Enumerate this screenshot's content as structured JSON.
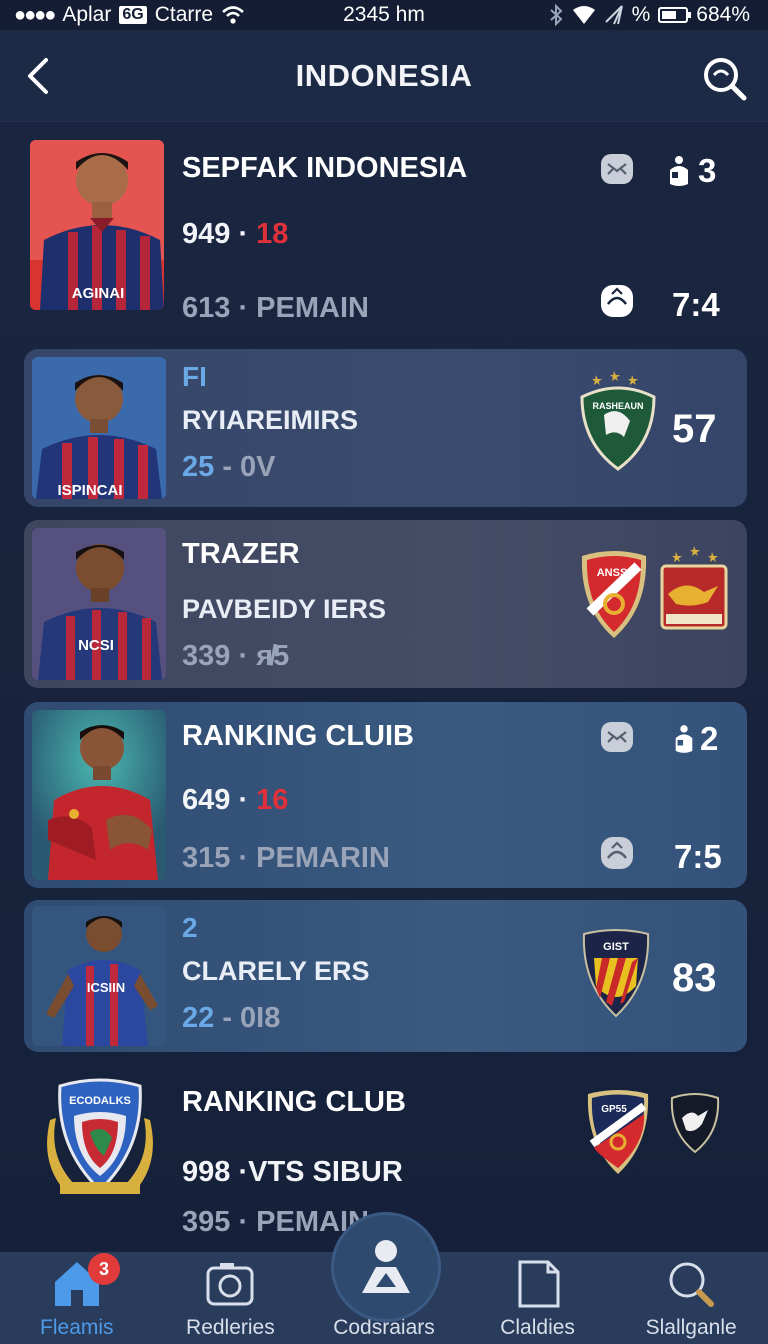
{
  "status_bar": {
    "carrier_left": "Aplar",
    "carrier_box": "6G",
    "carrier_name": "Ctarre",
    "time": "2345 hm",
    "percent_sign": "%",
    "battery": "684%"
  },
  "header": {
    "title": "INDONESIA"
  },
  "rows": [
    {
      "title": "SEPFAK INDONESIA",
      "stat_main": "949 ·",
      "stat_red": "18",
      "stat_dim": "613 ·",
      "label": "PEMAIN",
      "count_top": "3",
      "count_bottom": "7:4",
      "jersey_text": "AGINAI"
    },
    {
      "accent": "FI",
      "title": "RYIAREIMIRS",
      "stat_blue": "25",
      "stat_rest": "- 0V",
      "score": "57",
      "jersey_text": "ISPINCAI",
      "crest_text": "RASHEAUN"
    },
    {
      "title": "TRAZER",
      "sub": "PAVBEIDY IERS",
      "stat": "339 · ᴙ̸5",
      "jersey_text": "NCSI",
      "crest_text": "ANSS"
    },
    {
      "title": "RANKING CLUIB",
      "stat_main": "649 ·",
      "stat_red": "16",
      "stat_dim": "315 ·",
      "label": "PEMARIN",
      "count_top": "2",
      "count_bottom": "7:5"
    },
    {
      "accent": "2",
      "title": "CLARELY ERS",
      "stat_blue": "22",
      "stat_rest": "- 0I8",
      "score": "83",
      "jersey_text": "ICSIIN",
      "crest_text": "GIST"
    },
    {
      "title": "RANKING CLUB",
      "stat": "998 ·VTS SIBUR",
      "stat_dim": "395 ·",
      "label": "PEMAIN",
      "club_badge_text": "ECODALKS",
      "crest_text": "GP55"
    }
  ],
  "bottom_nav": {
    "items": [
      {
        "label": "Fleamis",
        "icon": "home-icon",
        "active": true,
        "badge": "3"
      },
      {
        "label": "Redleries",
        "icon": "camera-icon"
      },
      {
        "label": "Codsraiars",
        "icon": "person-icon"
      },
      {
        "label": "Claldies",
        "icon": "document-icon"
      },
      {
        "label": "Slallganle",
        "icon": "search-icon"
      }
    ]
  },
  "colors": {
    "background": "#18233c",
    "accent_blue": "#4d9ae8",
    "stat_red": "#e0303a",
    "badge_red": "#e03a3a"
  }
}
